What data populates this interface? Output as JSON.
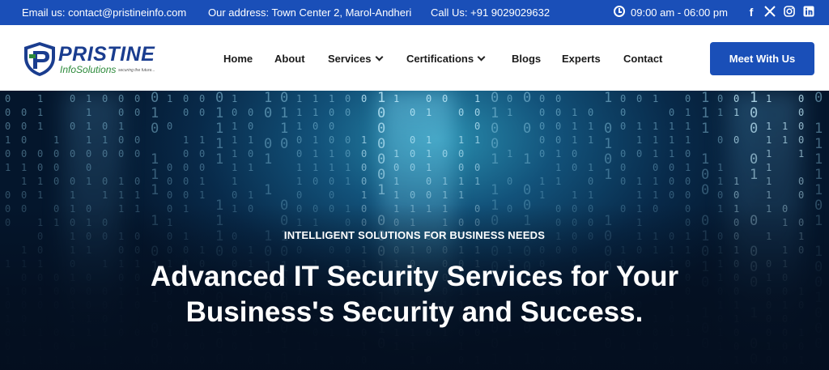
{
  "topbar": {
    "email": "Email us: contact@pristineinfo.com",
    "address": "Our address: Town Center 2, Marol-Andheri",
    "phone": "Call Us: +91 9029029632",
    "hours": "09:00 am - 06:00 pm",
    "social": [
      "facebook-icon",
      "x-icon",
      "instagram-icon",
      "linkedin-icon"
    ]
  },
  "brand": {
    "name": "PRISTINE",
    "sub": "InfoSolutions",
    "tagline": "securing the future..."
  },
  "nav": {
    "items": [
      {
        "label": "Home"
      },
      {
        "label": "About"
      },
      {
        "label": "Services"
      },
      {
        "label": "Certifications"
      },
      {
        "label": "Blogs"
      },
      {
        "label": "Experts"
      },
      {
        "label": "Contact"
      }
    ],
    "cta": "Meet With Us"
  },
  "hero": {
    "eyebrow": "INTELLIGENT SOLUTIONS FOR BUSINESS NEEDS",
    "headline": "Advanced IT Security Services for Your Business's Security and Success."
  },
  "colors": {
    "brand_blue": "#1a4fb8",
    "logo_navy": "#1a3d8f",
    "logo_green": "#2c8a3a"
  }
}
